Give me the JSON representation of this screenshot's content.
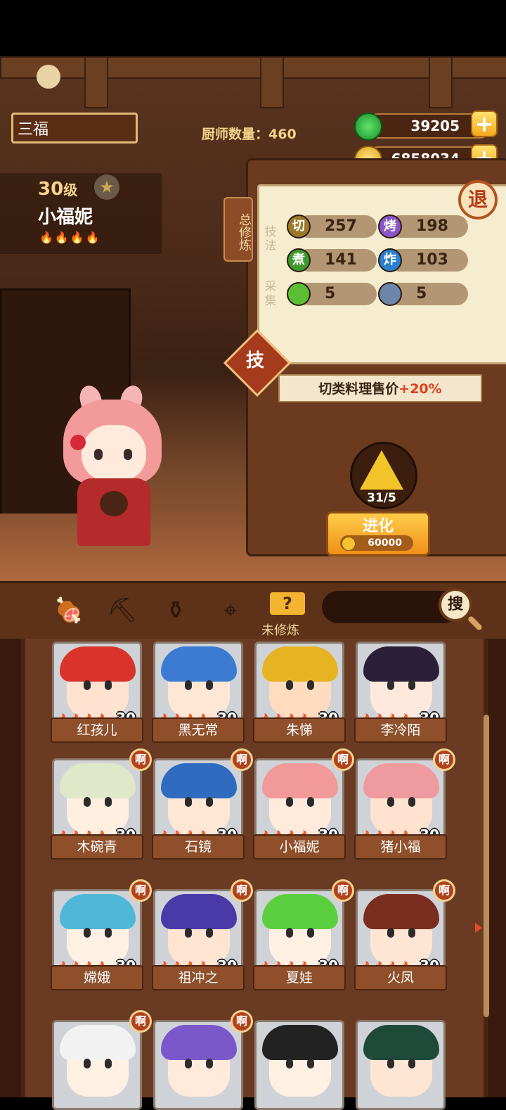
{
  "header": {
    "name_field": "三福",
    "chef_count": "厨师数量：460",
    "jade": "39205",
    "coins": "6858034"
  },
  "character": {
    "level": "30",
    "level_unit": "级",
    "name": "小福妮",
    "fire_rank": 4
  },
  "panel": {
    "side_tab": "总修炼",
    "retreat_button": "退",
    "technique_label": "技法",
    "gather_label": "采集",
    "skills": [
      {
        "icon": "切",
        "value": "257",
        "color": "#9a7a2a"
      },
      {
        "icon": "烤",
        "value": "198",
        "color": "#8a55c9"
      },
      {
        "icon": "煮",
        "value": "141",
        "color": "#3f9a2c"
      },
      {
        "icon": "炸",
        "value": "103",
        "color": "#2a7fcf"
      }
    ],
    "gather": [
      {
        "icon": "vegetable-icon",
        "value": "5",
        "color": "#5bbf33"
      },
      {
        "icon": "fish-icon",
        "value": "5",
        "color": "#6b86a8"
      }
    ],
    "skill_button": "技",
    "bonus_text_prefix": "切类料理售价",
    "bonus_text_value": "+20%",
    "evolve_progress": "31/5",
    "evolve_button": "进化",
    "evolve_cost": "60000"
  },
  "nav": {
    "unpracticed_label": "未修炼",
    "search_button": "搜",
    "tabs": [
      "meat-icon",
      "shovel-icon",
      "jar-icon",
      "location-icon",
      "question-book-icon"
    ]
  },
  "chefs": [
    {
      "name": "红孩儿",
      "level": "30",
      "hair": "#d9332b",
      "skin": "#ffe2cf",
      "badge": false
    },
    {
      "name": "黑无常",
      "level": "30",
      "hair": "#3b7bd1",
      "skin": "#ffe7d6",
      "badge": false
    },
    {
      "name": "朱悌",
      "level": "30",
      "hair": "#e6b422",
      "skin": "#ffdcc0",
      "badge": false
    },
    {
      "name": "李冷陌",
      "level": "30",
      "hair": "#2b1f3a",
      "skin": "#ffe9dc",
      "badge": false
    },
    {
      "name": "木碗青",
      "level": "30",
      "hair": "#dfe8c9",
      "skin": "#ffefe0",
      "badge": true
    },
    {
      "name": "石镜",
      "level": "30",
      "hair": "#2f6cc0",
      "skin": "#ffe7d6",
      "badge": true
    },
    {
      "name": "小福妮",
      "level": "30",
      "hair": "#f29a9a",
      "skin": "#ffeadb",
      "badge": true
    },
    {
      "name": "猪小福",
      "level": "30",
      "hair": "#ef9a9f",
      "skin": "#ffe2cf",
      "badge": true
    },
    {
      "name": "嫦娥",
      "level": "30",
      "hair": "#4fb7d8",
      "skin": "#fff0e4",
      "badge": true
    },
    {
      "name": "祖冲之",
      "level": "30",
      "hair": "#4a3aa8",
      "skin": "#ffe4d2",
      "badge": true
    },
    {
      "name": "夏娃",
      "level": "30",
      "hair": "#5ccf3e",
      "skin": "#fff0e4",
      "badge": true
    },
    {
      "name": "火凤",
      "level": "30",
      "hair": "#7a2e20",
      "skin": "#ffe6d4",
      "badge": true
    },
    {
      "name": "",
      "level": "",
      "hair": "#f2f2f2",
      "skin": "#fff0e4",
      "badge": true
    },
    {
      "name": "",
      "level": "",
      "hair": "#7b58c9",
      "skin": "#ffeadb",
      "badge": true
    },
    {
      "name": "",
      "level": "",
      "hair": "#222222",
      "skin": "#fff0e4",
      "badge": false
    },
    {
      "name": "",
      "level": "",
      "hair": "#1f4a3a",
      "skin": "#ffe6d4",
      "badge": false
    }
  ],
  "badge_text": "啊",
  "flame_glyph": "🔥"
}
